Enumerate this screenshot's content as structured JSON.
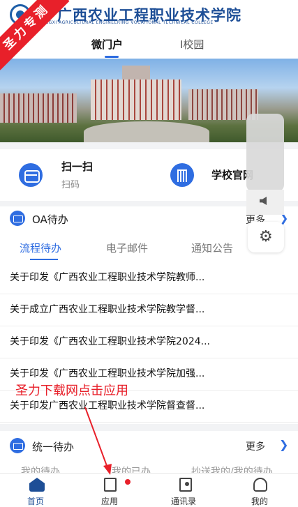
{
  "watermark": "圣力专测",
  "header": {
    "school_name": "广西农业工程职业技术学院",
    "school_name_en": "GUANGXI AGRICULTURAL ENGINEERING VOCATIONAL TECHNICAL COLLEGE"
  },
  "tabs": [
    {
      "label": "微门户",
      "active": true
    },
    {
      "label": "I校园",
      "active": false
    }
  ],
  "quick_actions": [
    {
      "title": "扫一扫",
      "subtitle": "扫码",
      "icon": "scan-icon"
    },
    {
      "title": "学校官网",
      "subtitle": "",
      "icon": "building-icon"
    }
  ],
  "oa": {
    "title": "OA待办",
    "more": "更多",
    "subtabs": [
      "流程待办",
      "电子邮件",
      "通知公告"
    ],
    "items": [
      "关于印发《广西农业工程职业技术学院教师...",
      "关于成立广西农业工程职业技术学院教学督...",
      "关于印发《广西农业工程职业技术学院2024...",
      "关于印发《广西农业工程职业技术学院加强...",
      "关于印发广西农业工程职业技术学院督查督..."
    ]
  },
  "unified": {
    "title": "统一待办",
    "more": "更多",
    "subtabs": [
      "我的待办",
      "我的已办",
      "抄送我的/我的待办"
    ]
  },
  "annotation": "圣力下载网点击应用",
  "nav": [
    {
      "label": "首页",
      "icon": "home-icon",
      "active": true
    },
    {
      "label": "应用",
      "icon": "app-icon",
      "active": false,
      "badge": true
    },
    {
      "label": "通讯录",
      "icon": "contacts-icon",
      "active": false
    },
    {
      "label": "我的",
      "icon": "profile-icon",
      "active": false
    }
  ],
  "colors": {
    "accent": "#2f6de1",
    "brand": "#1d4e96",
    "badge": "#e8202a"
  }
}
